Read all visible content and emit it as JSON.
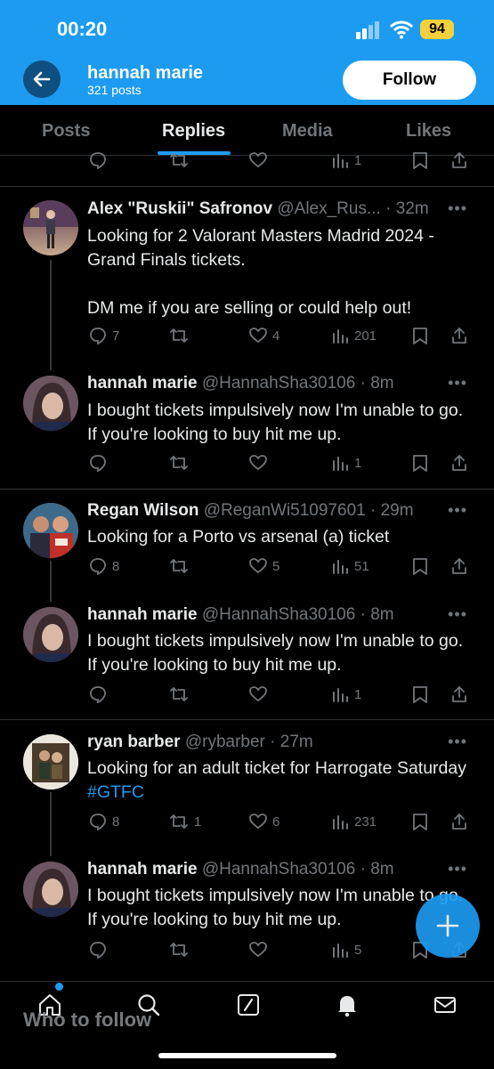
{
  "status": {
    "time": "00:20",
    "battery": "94"
  },
  "header": {
    "name": "hannah marie",
    "posts": "321 posts",
    "follow_label": "Follow"
  },
  "tabs": [
    {
      "label": "Posts"
    },
    {
      "label": "Replies"
    },
    {
      "label": "Media"
    },
    {
      "label": "Likes"
    }
  ],
  "top_actions": {
    "views": "1"
  },
  "posts": [
    {
      "name": "Alex \"Ruskii\" Safronov",
      "handle": "@Alex_Rus...",
      "time": "· 32m",
      "text": "Looking for 2 Valorant Masters Madrid 2024 - Grand Finals tickets.\n\nDM me if you are selling or could help out!",
      "replies": "7",
      "retweets": "",
      "likes": "4",
      "views": "201"
    },
    {
      "name": "hannah marie",
      "handle": "@HannahSha30106",
      "time": "· 8m",
      "text": "I bought tickets impulsively now I'm unable to go. If you're looking to buy hit me up.",
      "replies": "",
      "retweets": "",
      "likes": "",
      "views": "1"
    },
    {
      "name": "Regan Wilson",
      "handle": "@ReganWi51097601",
      "time": "· 29m",
      "text": "Looking for a Porto vs arsenal (a) ticket",
      "replies": "8",
      "retweets": "",
      "likes": "5",
      "views": "51"
    },
    {
      "name": "hannah marie",
      "handle": "@HannahSha30106",
      "time": "· 8m",
      "text": "I bought tickets impulsively now I'm unable to go. If you're looking to buy hit me up.",
      "replies": "",
      "retweets": "",
      "likes": "",
      "views": "1"
    },
    {
      "name": "ryan barber",
      "handle": "@rybarber",
      "time": "· 27m",
      "text_main": "Looking for an adult ticket for Harrogate Saturday ",
      "hashtag": "#GTFC",
      "replies": "8",
      "retweets": "1",
      "likes": "6",
      "views": "231"
    },
    {
      "name": "hannah marie",
      "handle": "@HannahSha30106",
      "time": "· 8m",
      "text": "I bought tickets impulsively now I'm unable to go. If you're looking to buy hit me up.",
      "replies": "",
      "retweets": "",
      "likes": "",
      "views": "5"
    }
  ],
  "bottom": {
    "who_to_follow": "Who to follow"
  },
  "colors": {
    "accent": "#1d9bf0",
    "background": "#000000",
    "muted": "#71767b"
  }
}
